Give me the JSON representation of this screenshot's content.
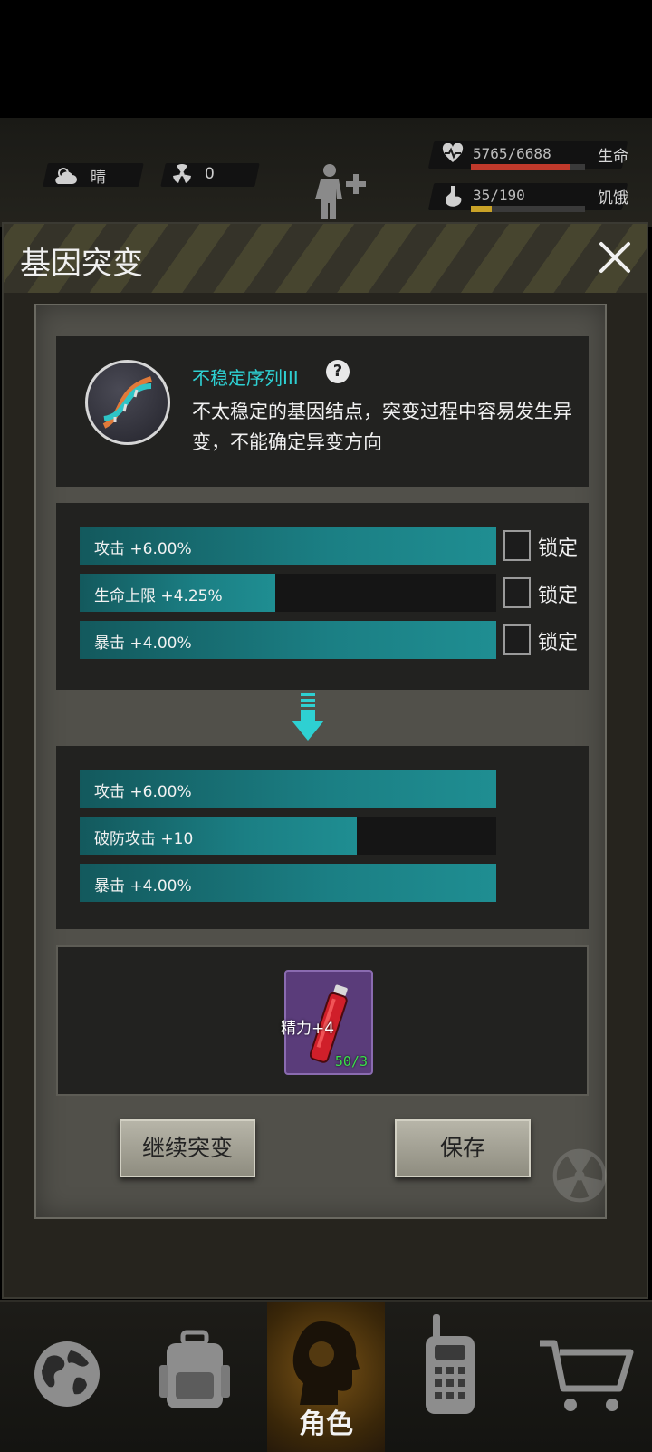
{
  "status_bar": {
    "weather": {
      "icon": "cloud-sun-icon",
      "label": "晴"
    },
    "radiation": {
      "icon": "radiation-icon",
      "value": "0"
    },
    "health": {
      "icon": "heartbeat-icon",
      "value": "5765/6688",
      "label": "生命",
      "fraction": 0.862,
      "color": "#c0392b"
    },
    "hunger": {
      "icon": "stomach-icon",
      "value": "35/190",
      "label": "饥饿",
      "fraction": 0.184,
      "color": "#c9a227"
    },
    "character_icon": "body-plus-icon"
  },
  "dialog": {
    "title": "基因突变",
    "close_icon": "close-icon",
    "gene": {
      "icon": "dna-icon",
      "name": "不稳定序列III",
      "help_icon": "question-icon",
      "description": "不太稳定的基因结点，突变过程中容易发生异变，不能确定异变方向"
    },
    "current_attributes": [
      {
        "label": "攻击 +6.00%",
        "fraction": 1.0,
        "lock_label": "锁定",
        "locked": false
      },
      {
        "label": "生命上限 +4.25%",
        "fraction": 0.47,
        "lock_label": "锁定",
        "locked": false
      },
      {
        "label": "暴击 +4.00%",
        "fraction": 1.0,
        "lock_label": "锁定",
        "locked": false
      }
    ],
    "arrow_icon": "arrow-down-icon",
    "new_attributes": [
      {
        "label": "攻击 +6.00%",
        "fraction": 1.0
      },
      {
        "label": "破防攻击 +10",
        "fraction": 0.665
      },
      {
        "label": "暴击 +4.00%",
        "fraction": 1.0
      }
    ],
    "cost_item": {
      "icon": "vial-icon",
      "name": "精力+4",
      "count": "50/3"
    },
    "buttons": {
      "continue": "继续突变",
      "save": "保存"
    }
  },
  "nav": [
    {
      "icon": "globe-icon",
      "label": ""
    },
    {
      "icon": "backpack-icon",
      "label": ""
    },
    {
      "icon": "character-head-icon",
      "label": "角色",
      "active": true
    },
    {
      "icon": "walkie-talkie-icon",
      "label": ""
    },
    {
      "icon": "cart-icon",
      "label": ""
    }
  ]
}
